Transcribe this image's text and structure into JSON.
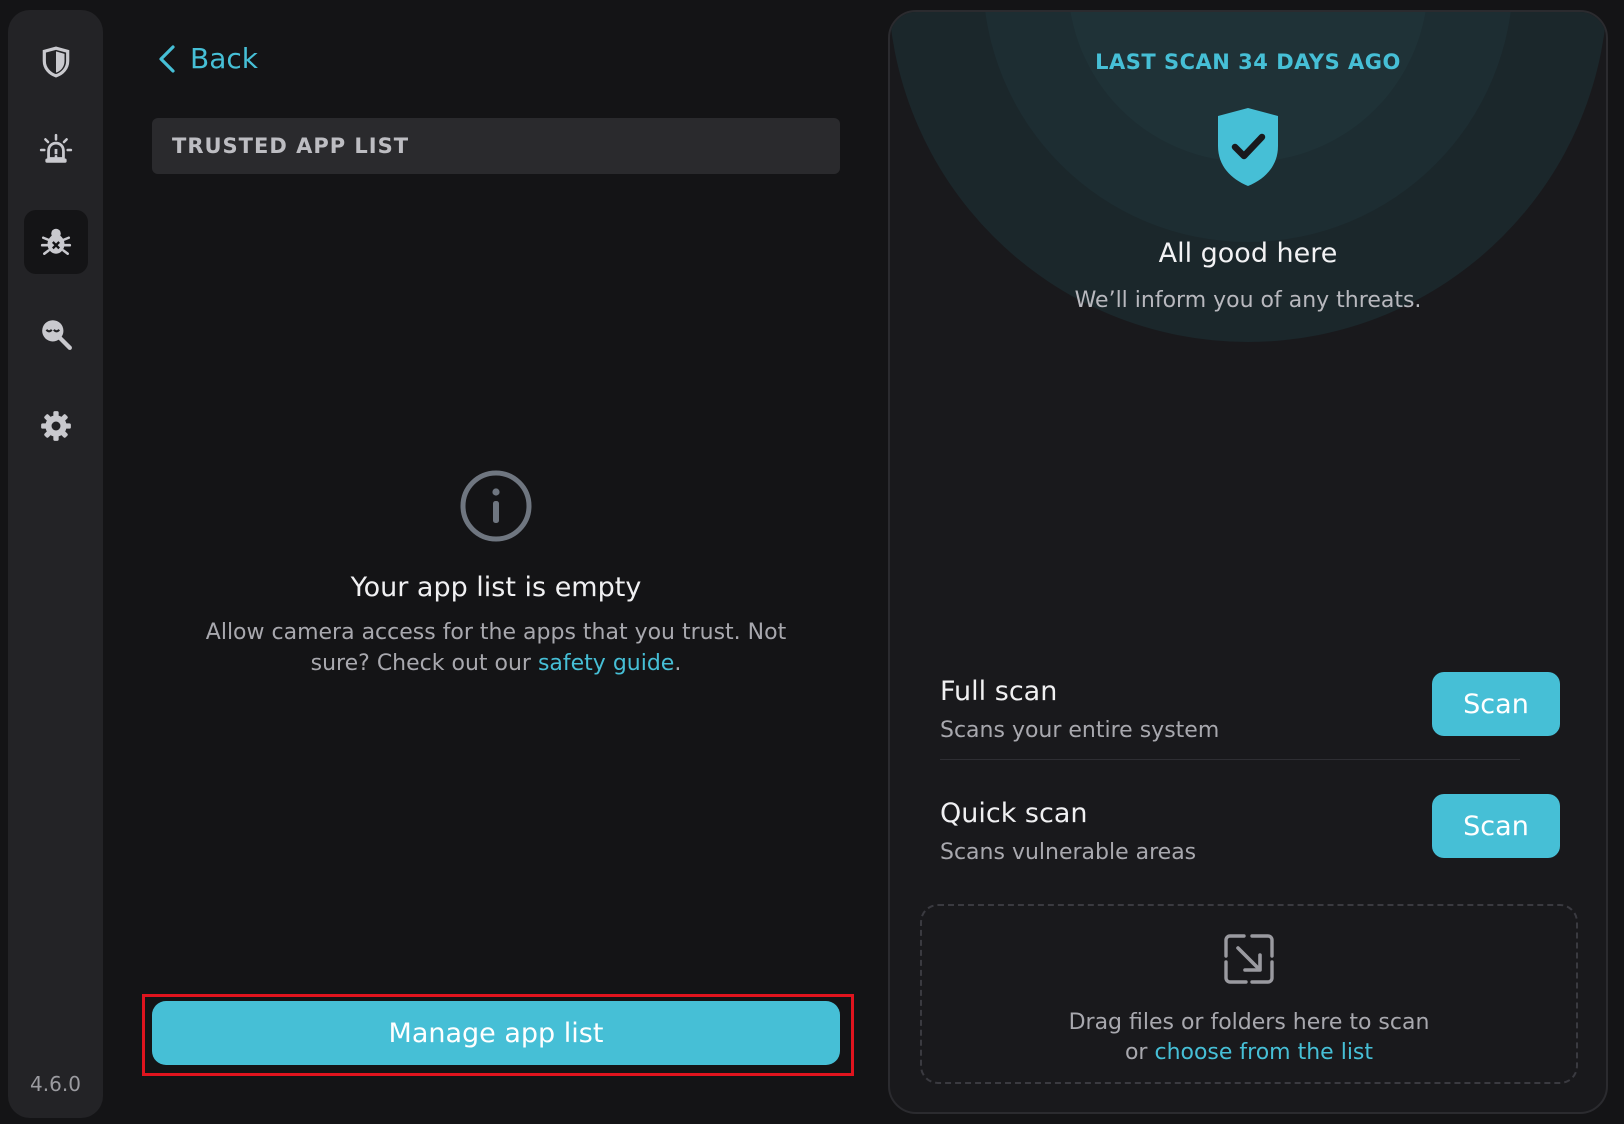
{
  "sidebar": {
    "items": [
      {
        "icon": "shield-icon"
      },
      {
        "icon": "alarm-icon"
      },
      {
        "icon": "bug-icon",
        "active": true
      },
      {
        "icon": "spy-search-icon"
      },
      {
        "icon": "gear-icon"
      }
    ],
    "version": "4.6.0"
  },
  "header": {
    "back_label": "Back",
    "section_title": "TRUSTED APP LIST"
  },
  "empty_state": {
    "title": "Your app list is empty",
    "desc_prefix": "Allow camera access for the apps that you trust. Not sure? Check out our ",
    "desc_link": "safety guide",
    "desc_suffix": "."
  },
  "manage_button": "Manage app list",
  "status": {
    "last_scan": "LAST SCAN 34 DAYS AGO",
    "title": "All good here",
    "subtitle": "We’ll inform you of any threats."
  },
  "scans": [
    {
      "title": "Full scan",
      "desc": "Scans your entire system",
      "button": "Scan"
    },
    {
      "title": "Quick scan",
      "desc": "Scans vulnerable areas",
      "button": "Scan"
    }
  ],
  "drop_zone": {
    "line1": "Drag files or folders here to scan",
    "line2_prefix": "or ",
    "line2_link": "choose from the list"
  },
  "colors": {
    "accent": "#46bfd6",
    "background": "#141416",
    "highlight": "#e0141e"
  }
}
